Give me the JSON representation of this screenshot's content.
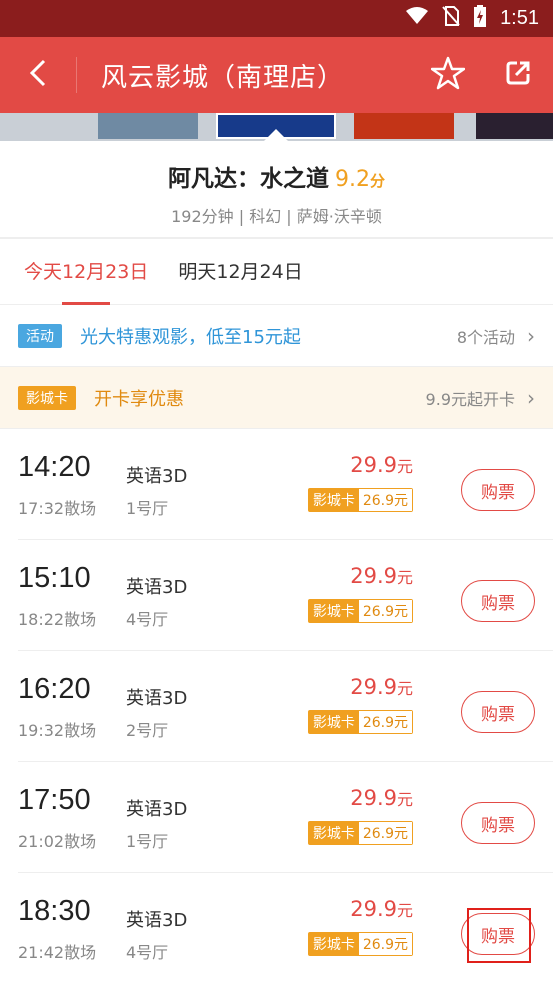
{
  "status_bar": {
    "time": "1:51"
  },
  "header": {
    "title": "风云影城（南理店）",
    "back_icon": "back-arrow-icon",
    "favorite_icon": "star-icon",
    "share_icon": "share-icon"
  },
  "movie": {
    "name": "阿凡达：水之道",
    "score": "9.2",
    "score_unit": "分",
    "meta": "192分钟 | 科幻 | 萨姆·沃辛顿"
  },
  "date_tabs": [
    {
      "label": "今天12月23日",
      "active": true
    },
    {
      "label": "明天12月24日",
      "active": false
    }
  ],
  "promos": {
    "activity": {
      "badge": "活动",
      "text": "光大特惠观影，低至15元起",
      "right": "8个活动",
      "badge_color": "#4aa7e0",
      "text_color": "#2f95d8"
    },
    "card": {
      "badge": "影城卡",
      "text": "开卡享优惠",
      "right": "9.9元起开卡",
      "badge_color": "#f0a020",
      "text_color": "#e08a10"
    }
  },
  "showtimes": [
    {
      "time": "14:20",
      "end": "17:32散场",
      "lang": "英语3D",
      "hall": "1号厅",
      "price": "29.9",
      "price_unit": "元",
      "card_label": "影城卡",
      "card_price": "26.9元",
      "buy": "购票"
    },
    {
      "time": "15:10",
      "end": "18:22散场",
      "lang": "英语3D",
      "hall": "4号厅",
      "price": "29.9",
      "price_unit": "元",
      "card_label": "影城卡",
      "card_price": "26.9元",
      "buy": "购票"
    },
    {
      "time": "16:20",
      "end": "19:32散场",
      "lang": "英语3D",
      "hall": "2号厅",
      "price": "29.9",
      "price_unit": "元",
      "card_label": "影城卡",
      "card_price": "26.9元",
      "buy": "购票"
    },
    {
      "time": "17:50",
      "end": "21:02散场",
      "lang": "英语3D",
      "hall": "1号厅",
      "price": "29.9",
      "price_unit": "元",
      "card_label": "影城卡",
      "card_price": "26.9元",
      "buy": "购票"
    },
    {
      "time": "18:30",
      "end": "21:42散场",
      "lang": "英语3D",
      "hall": "4号厅",
      "price": "29.9",
      "price_unit": "元",
      "card_label": "影城卡",
      "card_price": "26.9元",
      "buy": "购票"
    }
  ],
  "colors": {
    "accent": "#e24a45",
    "status_bar": "#8b1d1d",
    "gold": "#f0a020"
  }
}
